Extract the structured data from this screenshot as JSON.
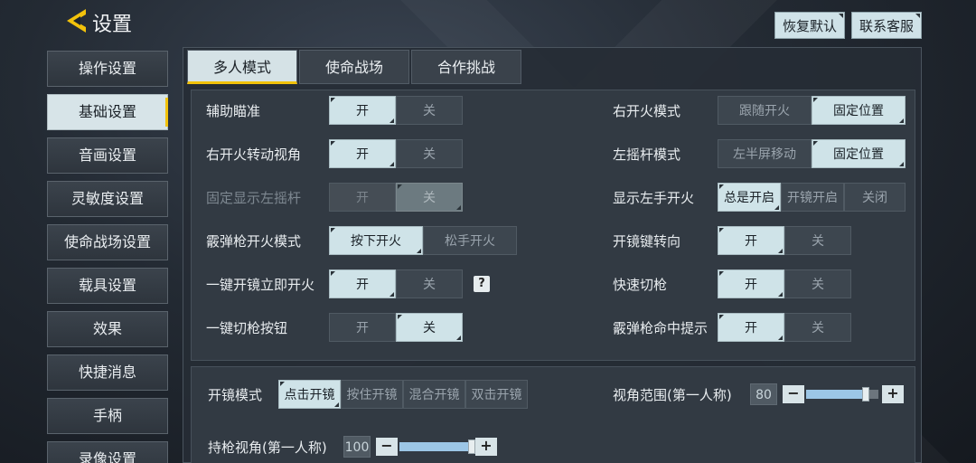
{
  "header": {
    "title": "设置",
    "restore_label": "恢复默认",
    "support_label": "联系客服"
  },
  "sidebar": {
    "items": [
      {
        "label": "操作设置",
        "active": false
      },
      {
        "label": "基础设置",
        "active": true
      },
      {
        "label": "音画设置",
        "active": false
      },
      {
        "label": "灵敏度设置",
        "active": false
      },
      {
        "label": "使命战场设置",
        "active": false
      },
      {
        "label": "载具设置",
        "active": false
      },
      {
        "label": "效果",
        "active": false
      },
      {
        "label": "快捷消息",
        "active": false
      },
      {
        "label": "手柄",
        "active": false
      },
      {
        "label": "录像设置",
        "active": false
      }
    ]
  },
  "tabs": [
    {
      "label": "多人模式",
      "active": true
    },
    {
      "label": "使命战场",
      "active": false
    },
    {
      "label": "合作挑战",
      "active": false
    }
  ],
  "left_settings": [
    {
      "label": "辅助瞄准",
      "options": [
        "开",
        "关"
      ],
      "selected": 0
    },
    {
      "label": "右开火转动视角",
      "options": [
        "开",
        "关"
      ],
      "selected": 0
    },
    {
      "label": "固定显示左摇杆",
      "options": [
        "开",
        "关"
      ],
      "selected": 1,
      "disabled": true
    },
    {
      "label": "霰弹枪开火模式",
      "options": [
        "按下开火",
        "松手开火"
      ],
      "selected": 0
    },
    {
      "label": "一键开镜立即开火",
      "options": [
        "开",
        "关"
      ],
      "selected": 0,
      "help": "?"
    },
    {
      "label": "一键切枪按钮",
      "options": [
        "开",
        "关"
      ],
      "selected": 1
    }
  ],
  "right_settings": [
    {
      "label": "右开火模式",
      "options": [
        "跟随开火",
        "固定位置"
      ],
      "selected": 1
    },
    {
      "label": "左摇杆模式",
      "options": [
        "左半屏移动",
        "固定位置"
      ],
      "selected": 1
    },
    {
      "label": "显示左手开火",
      "options": [
        "总是开启",
        "开镜开启",
        "关闭"
      ],
      "selected": 0
    },
    {
      "label": "开镜键转向",
      "options": [
        "开",
        "关"
      ],
      "selected": 0
    },
    {
      "label": "快速切枪",
      "options": [
        "开",
        "关"
      ],
      "selected": 0
    },
    {
      "label": "霰弹枪命中提示",
      "options": [
        "开",
        "关"
      ],
      "selected": 0
    }
  ],
  "scope": {
    "label": "开镜模式",
    "options": [
      "点击开镜",
      "按住开镜",
      "混合开镜",
      "双击开镜"
    ],
    "selected": 0
  },
  "fov_first": {
    "label": "视角范围(第一人称)",
    "value": "80",
    "level": 0.82,
    "minus": "−",
    "plus": "+"
  },
  "hold_fov": {
    "label": "持枪视角(第一人称)",
    "value": "100",
    "level": 1.0,
    "minus": "−",
    "plus": "+"
  },
  "colors": {
    "accent": "#f2c20b",
    "selected": "#cfe3e8"
  }
}
